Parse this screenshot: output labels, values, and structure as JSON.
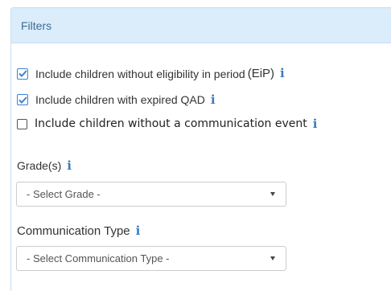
{
  "panel": {
    "title": "Filters"
  },
  "checkboxes": [
    {
      "label": "Include children without eligibility in period",
      "suffix": "(EiP)",
      "checked": true
    },
    {
      "label": "Include children with expired QAD",
      "checked": true
    },
    {
      "label": "Include children without a communication event",
      "checked": false
    }
  ],
  "info_glyph": "i",
  "grades": {
    "label": "Grade(s)",
    "selected": "- Select Grade -"
  },
  "communication_type": {
    "label": "Communication Type",
    "selected": "- Select Communication Type -"
  },
  "colors": {
    "header_bg": "#dbecfa",
    "accent": "#3b82d6",
    "info_icon": "#3a7bbf",
    "header_text": "#3a6e96"
  },
  "icons": [
    "checkbox-checked-icon",
    "checkbox-unchecked-icon",
    "info-icon",
    "caret-down-icon"
  ]
}
